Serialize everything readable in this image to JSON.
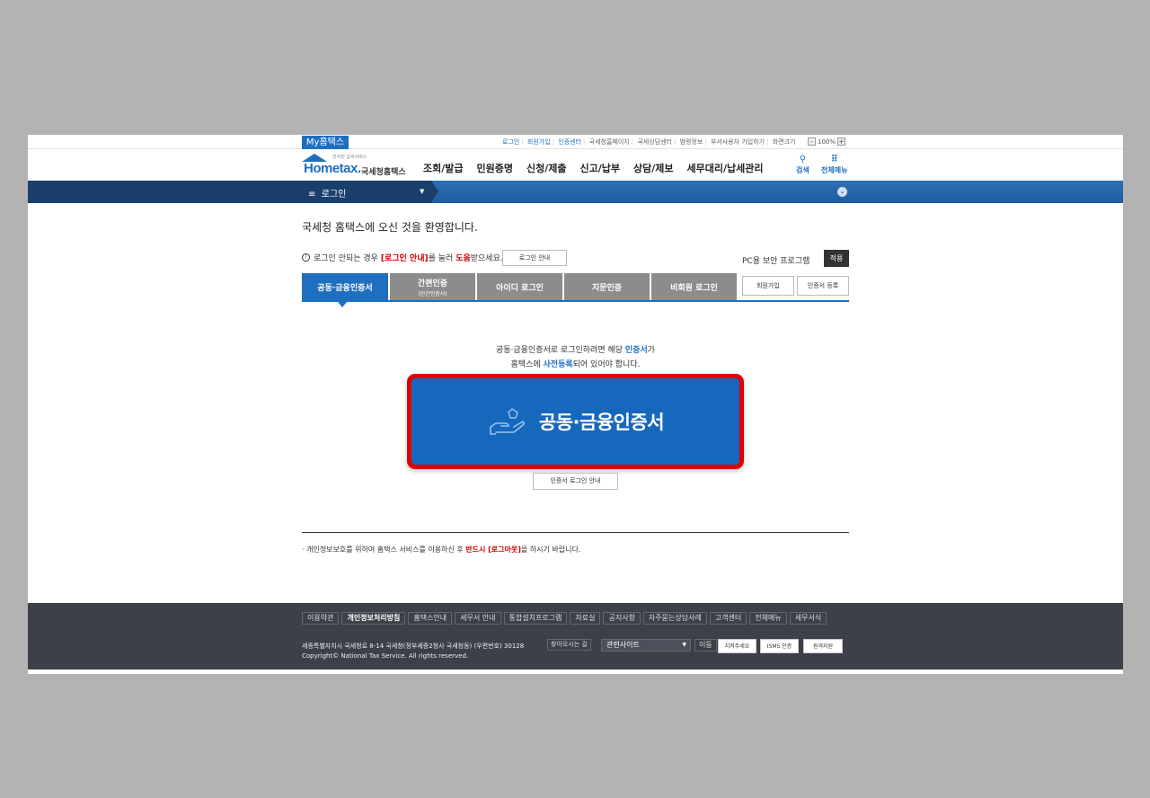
{
  "util": {
    "my_tab": "My홈택스",
    "links": [
      "로그인",
      "회원가입",
      "인증센터",
      "국세청홈페이지",
      "국세상담센터",
      "범령정보",
      "부서사용자 가입하기",
      "화면크기"
    ],
    "zoom_minus": "-",
    "zoom_value": "100%",
    "zoom_plus": "+"
  },
  "header": {
    "logo_word": "Hometax.",
    "logo_tagline": "전자된 납세서비스",
    "logo_korean": "국세청홈택스",
    "menu": [
      "조회/발급",
      "민원증명",
      "신청/제출",
      "신고/납부",
      "상담/제보",
      "세무대리/납세관리"
    ],
    "search_label": "검색",
    "all_menu_label": "전체메뉴"
  },
  "navbar": {
    "menu_glyph": "≡",
    "current": "로그인"
  },
  "main": {
    "welcome": "국세청 홈택스에 오신 것을 환영합니다.",
    "info_pre": "로그인 안되는 경우",
    "info_red": "[로그인 안내]",
    "info_mid": "를 눌러",
    "info_red2": "도움",
    "info_post": "받으세요.",
    "login_guide_btn": "로그인 안내",
    "pc_security": "PC용 보안 프로그램",
    "apply_btn": "적용",
    "tabs": [
      {
        "label": "공동·금융인증서",
        "sub": ""
      },
      {
        "label": "간편인증",
        "sub": "(민간인증서)"
      },
      {
        "label": "아이디 로그인",
        "sub": ""
      },
      {
        "label": "지문인증",
        "sub": ""
      },
      {
        "label": "비회원 로그인",
        "sub": ""
      }
    ],
    "join_btn": "회원가입",
    "cert_register_btn": "인증서 등록",
    "desc_line1_pre": "공동·금융인증서로 로그인하려면 해당",
    "desc_line1_blue": "인증서",
    "desc_line1_post": "가",
    "desc_line2_pre": "홈택스에",
    "desc_line2_blue": "사전등록",
    "desc_line2_post": "되어 있어야 합니다.",
    "cert_button_label": "공동·금융인증서",
    "cert_guide_btn": "인증서 로그인 안내",
    "notice_pre": "개인정보보호를 위하여 홈택스 서비스를 이용하신 후",
    "notice_red": "반드시 [로그아웃]",
    "notice_post": "을 하시기 바랍니다."
  },
  "footer": {
    "links": [
      "이용약관",
      "개인정보처리방침",
      "홈택스안내",
      "세무서 안내",
      "통합설치프로그램",
      "자료실",
      "공지사항",
      "자주묻는상담사례",
      "고객센터",
      "전체메뉴",
      "세무서식"
    ],
    "address": "세종특별자치시 국세청로 8-14 국세청(정부세종2청사 국세청동) (우편번호) 30128",
    "copyright": "Copyright© National Tax Service. All rights reserved.",
    "find_way": "찾아오시는 길",
    "related_sites": "관련사이트",
    "move_btn": "이동",
    "badge1": "지켜주세요",
    "badge2": "ISMS 인증",
    "badge3": "원격지원"
  },
  "colors": {
    "primary": "#1f6fc0",
    "highlight_border": "#e00000",
    "tab_inactive": "#8c8c8c",
    "footer_bg": "#3e4049"
  }
}
